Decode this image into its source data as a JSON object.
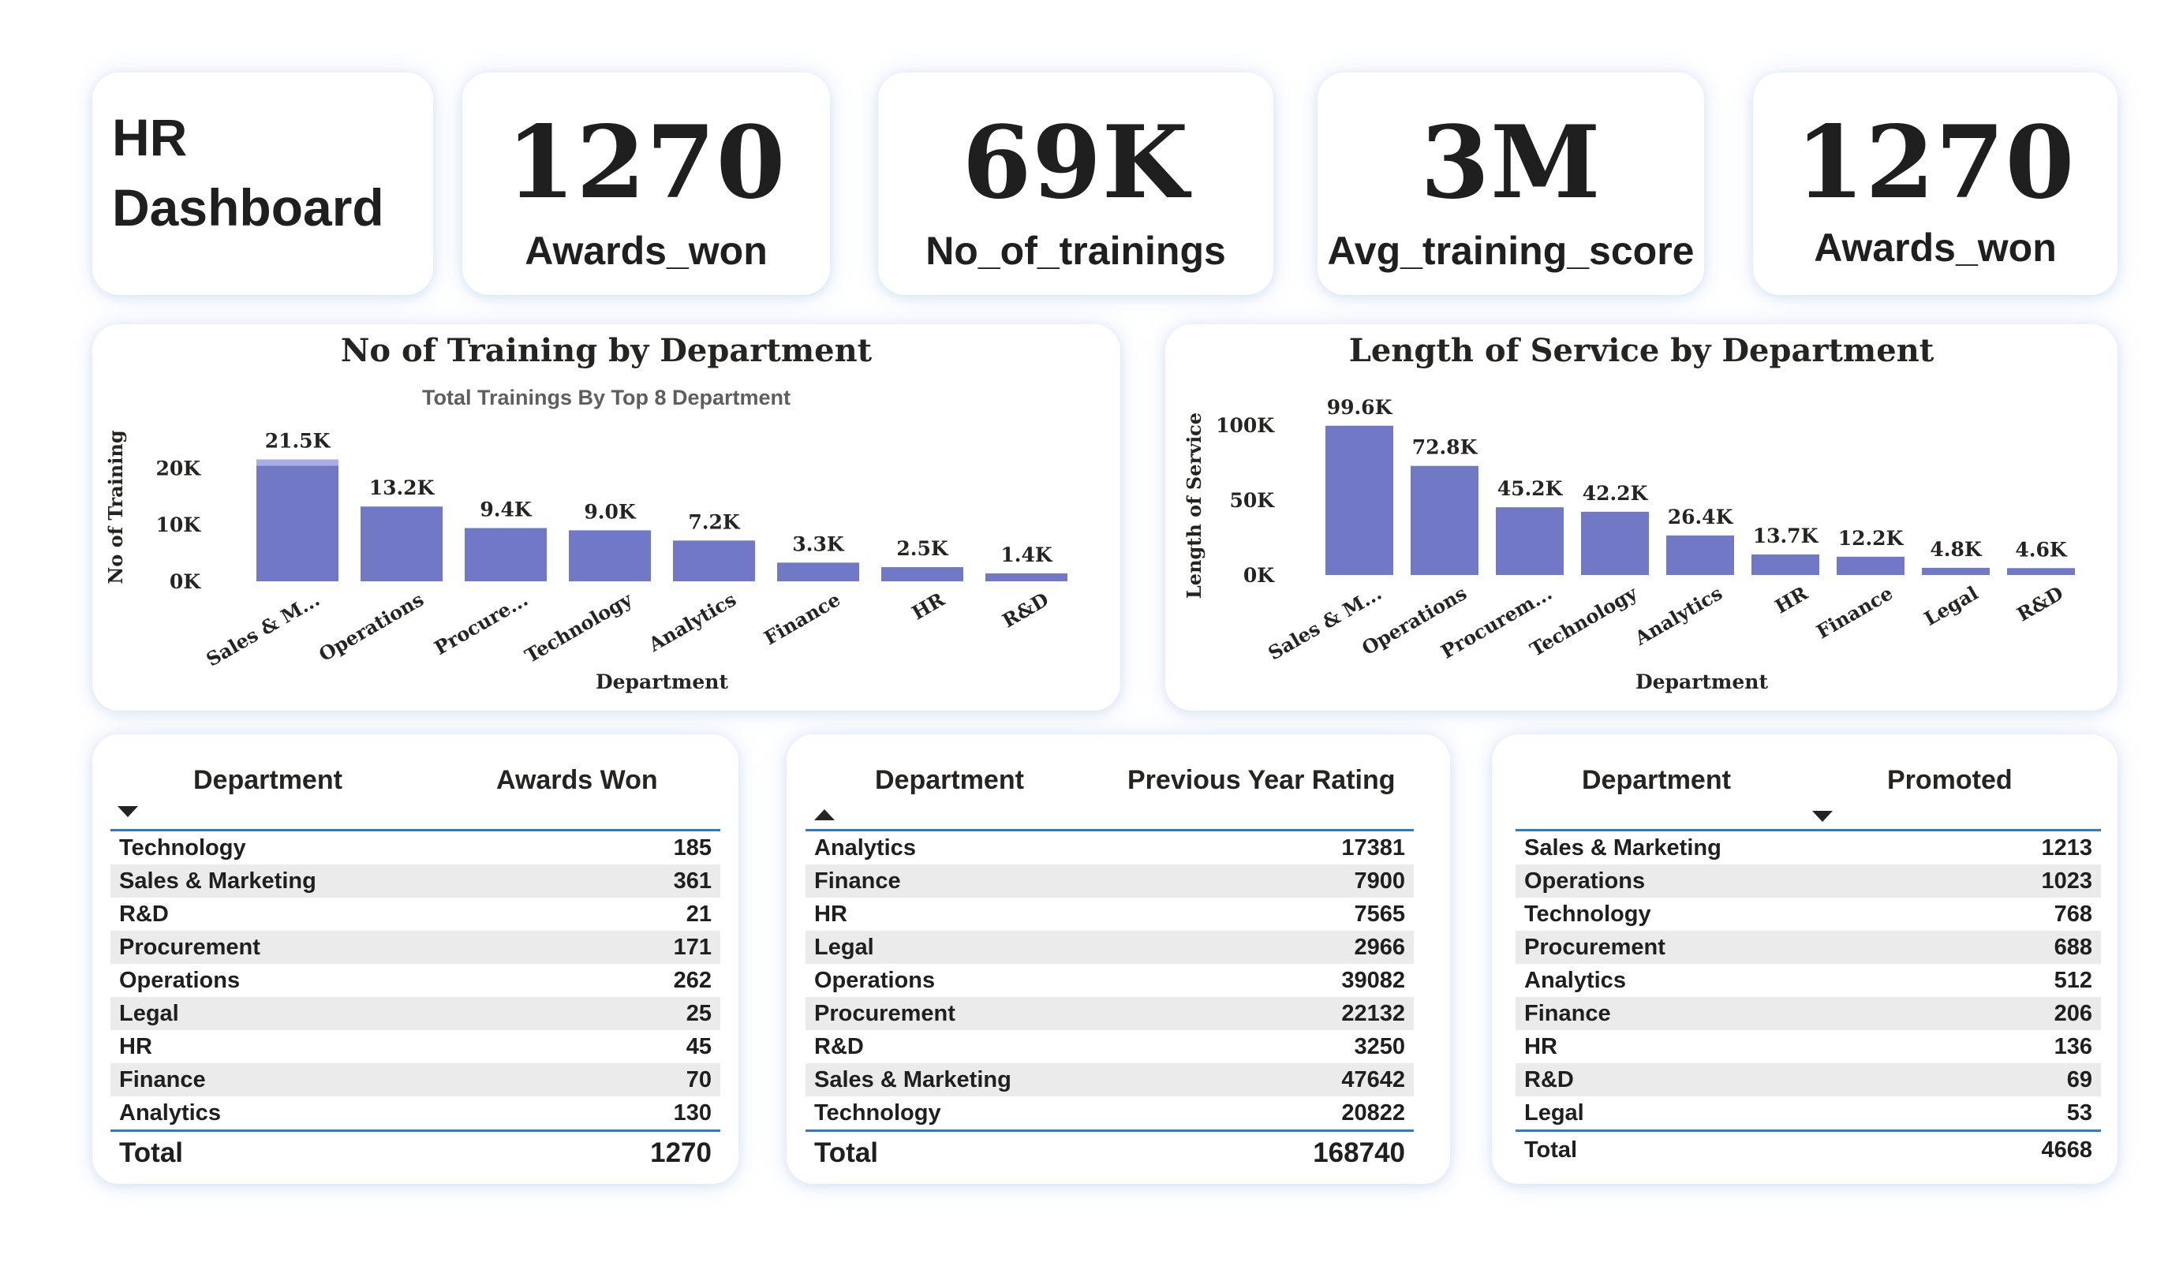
{
  "dashboard_title": "HR\nDashboard",
  "kpis": [
    {
      "value": "1270",
      "label": "Awards_won"
    },
    {
      "value": "69K",
      "label": "No_of_trainings"
    },
    {
      "value": "3M",
      "label": "Avg_training_score"
    },
    {
      "value": "1270",
      "label": "Awards_won"
    }
  ],
  "chart_data": [
    {
      "type": "bar",
      "title": "No of Training by Department",
      "subtitle": "Total Trainings By Top 8 Department",
      "xlabel": "Department",
      "ylabel": "No of Training",
      "categories": [
        "Sales & M...",
        "Operations",
        "Procure...",
        "Technology",
        "Analytics",
        "Finance",
        "HR",
        "R&D"
      ],
      "values": [
        21500,
        13200,
        9400,
        9000,
        7200,
        3300,
        2500,
        1400
      ],
      "data_labels": [
        "21.5K",
        "13.2K",
        "9.4K",
        "9.0K",
        "7.2K",
        "3.3K",
        "2.5K",
        "1.4K"
      ],
      "yticks": [
        "0K",
        "10K",
        "20K"
      ],
      "ytick_values": [
        0,
        10000,
        20000
      ],
      "ylim": [
        0,
        22000
      ],
      "grid": false,
      "bar_color": "#7179c6",
      "highlight_color": "#a9ade3"
    },
    {
      "type": "bar",
      "title": "Length of Service by Department",
      "xlabel": "Department",
      "ylabel": "Length of Service",
      "categories": [
        "Sales & M...",
        "Operations",
        "Procurem...",
        "Technology",
        "Analytics",
        "HR",
        "Finance",
        "Legal",
        "R&D"
      ],
      "values": [
        99600,
        72800,
        45200,
        42200,
        26400,
        13700,
        12200,
        4800,
        4600
      ],
      "data_labels": [
        "99.6K",
        "72.8K",
        "45.2K",
        "42.2K",
        "26.4K",
        "13.7K",
        "12.2K",
        "4.8K",
        "4.6K"
      ],
      "yticks": [
        "0K",
        "50K",
        "100K"
      ],
      "ytick_values": [
        0,
        50000,
        100000
      ],
      "ylim": [
        0,
        100000
      ],
      "grid": false,
      "bar_color": "#7179c6"
    }
  ],
  "tables": [
    {
      "col1": "Department",
      "col2": "Awards Won",
      "sort": "desc",
      "rows": [
        {
          "name": "Technology",
          "value": "185"
        },
        {
          "name": "Sales & Marketing",
          "value": "361"
        },
        {
          "name": "R&D",
          "value": "21"
        },
        {
          "name": "Procurement",
          "value": "171"
        },
        {
          "name": "Operations",
          "value": "262"
        },
        {
          "name": "Legal",
          "value": "25"
        },
        {
          "name": "HR",
          "value": "45"
        },
        {
          "name": "Finance",
          "value": "70"
        },
        {
          "name": "Analytics",
          "value": "130"
        }
      ],
      "total_label": "Total",
      "total_value": "1270"
    },
    {
      "col1": "Department",
      "col2": "Previous Year Rating",
      "sort": "asc",
      "rows": [
        {
          "name": "Analytics",
          "value": "17381"
        },
        {
          "name": "Finance",
          "value": "7900"
        },
        {
          "name": "HR",
          "value": "7565"
        },
        {
          "name": "Legal",
          "value": "2966"
        },
        {
          "name": "Operations",
          "value": "39082"
        },
        {
          "name": "Procurement",
          "value": "22132"
        },
        {
          "name": "R&D",
          "value": "3250"
        },
        {
          "name": "Sales & Marketing",
          "value": "47642"
        },
        {
          "name": "Technology",
          "value": "20822"
        }
      ],
      "total_label": "Total",
      "total_value": "168740"
    },
    {
      "col1": "Department",
      "col2": "Promoted",
      "sort": "desc",
      "rows": [
        {
          "name": "Sales & Marketing",
          "value": "1213"
        },
        {
          "name": "Operations",
          "value": "1023"
        },
        {
          "name": "Technology",
          "value": "768"
        },
        {
          "name": "Procurement",
          "value": "688"
        },
        {
          "name": "Analytics",
          "value": "512"
        },
        {
          "name": "Finance",
          "value": "206"
        },
        {
          "name": "HR",
          "value": "136"
        },
        {
          "name": "R&D",
          "value": "69"
        },
        {
          "name": "Legal",
          "value": "53"
        }
      ],
      "total_label": "Total",
      "total_value": "4668"
    }
  ]
}
